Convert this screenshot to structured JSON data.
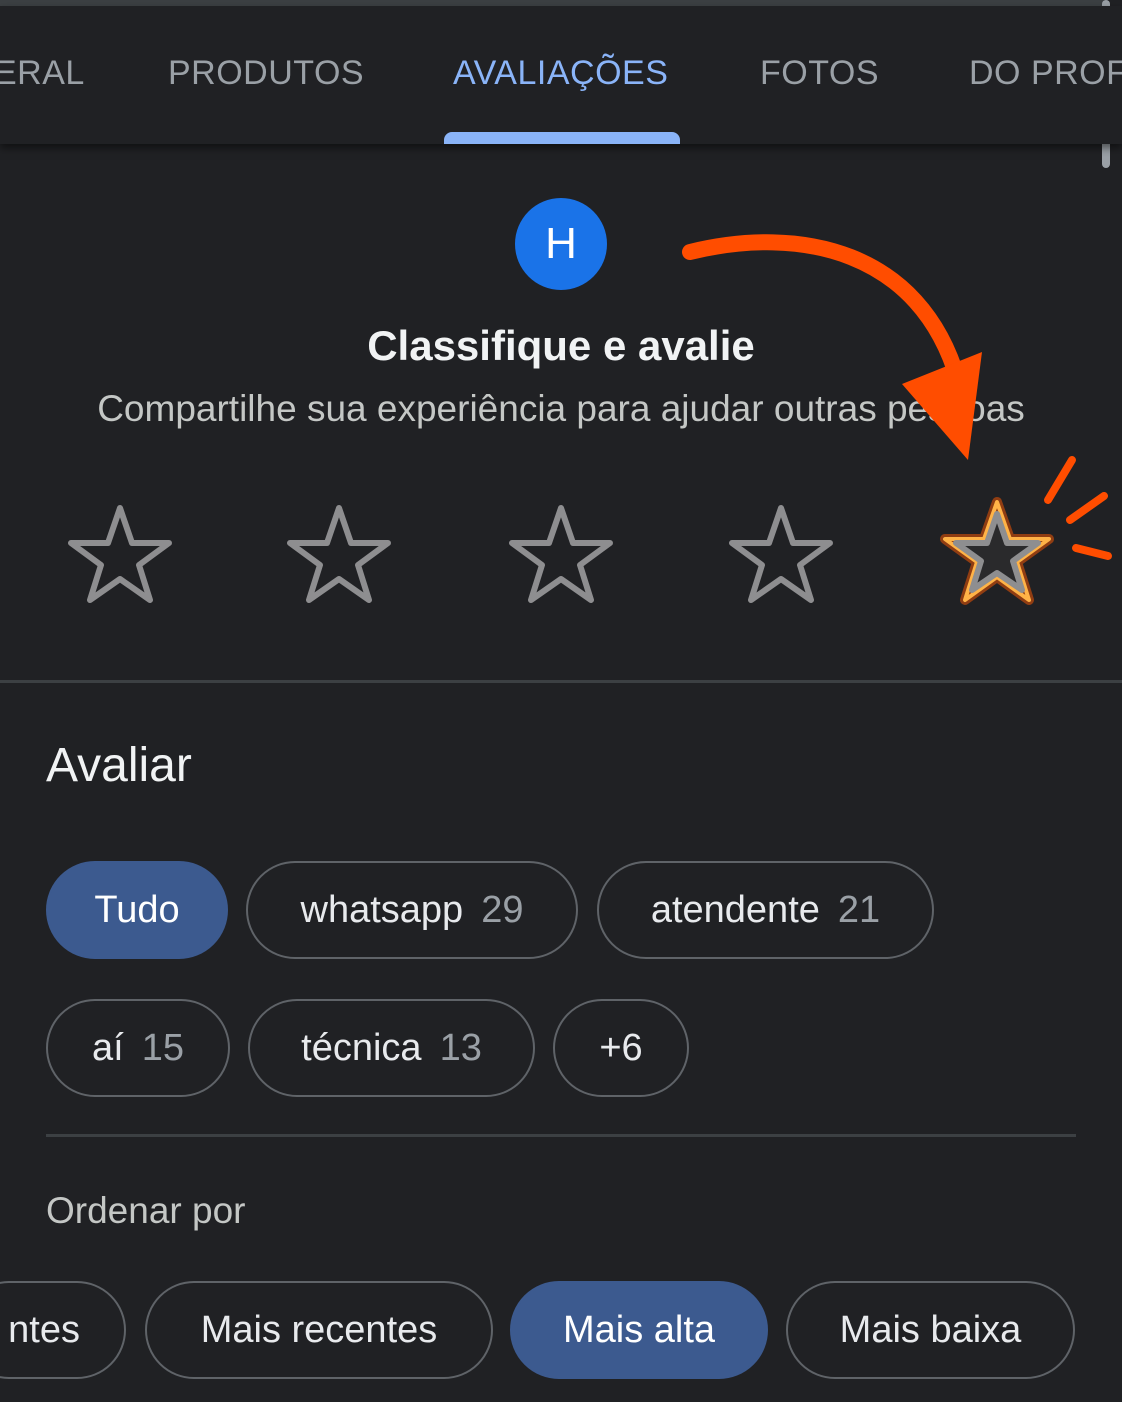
{
  "tabs": [
    {
      "label": "ERAL",
      "active": false
    },
    {
      "label": "PRODUTOS",
      "active": false
    },
    {
      "label": "AVALIAÇÕES",
      "active": true
    },
    {
      "label": "FOTOS",
      "active": false
    },
    {
      "label": "DO PROF",
      "active": false
    }
  ],
  "rate": {
    "avatar_letter": "H",
    "title": "Classifique e avalie",
    "subtitle": "Compartilhe sua experiência para ajudar outras pessoas",
    "stars": 5,
    "highlighted_star": 5
  },
  "reviews": {
    "section_title": "Avaliar",
    "filters": [
      {
        "label": "Tudo",
        "count": "",
        "selected": true
      },
      {
        "label": "whatsapp",
        "count": "29",
        "selected": false
      },
      {
        "label": "atendente",
        "count": "21",
        "selected": false
      },
      {
        "label": "aí",
        "count": "15",
        "selected": false
      },
      {
        "label": "técnica",
        "count": "13",
        "selected": false
      },
      {
        "label": "+6",
        "count": "",
        "selected": false
      }
    ],
    "sort_label": "Ordenar por",
    "sort_options": [
      {
        "label": "ntes",
        "selected": false
      },
      {
        "label": "Mais recentes",
        "selected": false
      },
      {
        "label": "Mais alta",
        "selected": true
      },
      {
        "label": "Mais baixa",
        "selected": false
      }
    ]
  },
  "colors": {
    "background": "#202124",
    "accent": "#8ab4f8",
    "chip_selected": "#3c5a8f",
    "avatar": "#1a73e8",
    "annotation": "#ff5a00"
  },
  "icons": {
    "rating_star": "star-outline-icon",
    "annotation": "curved-arrow-icon"
  }
}
